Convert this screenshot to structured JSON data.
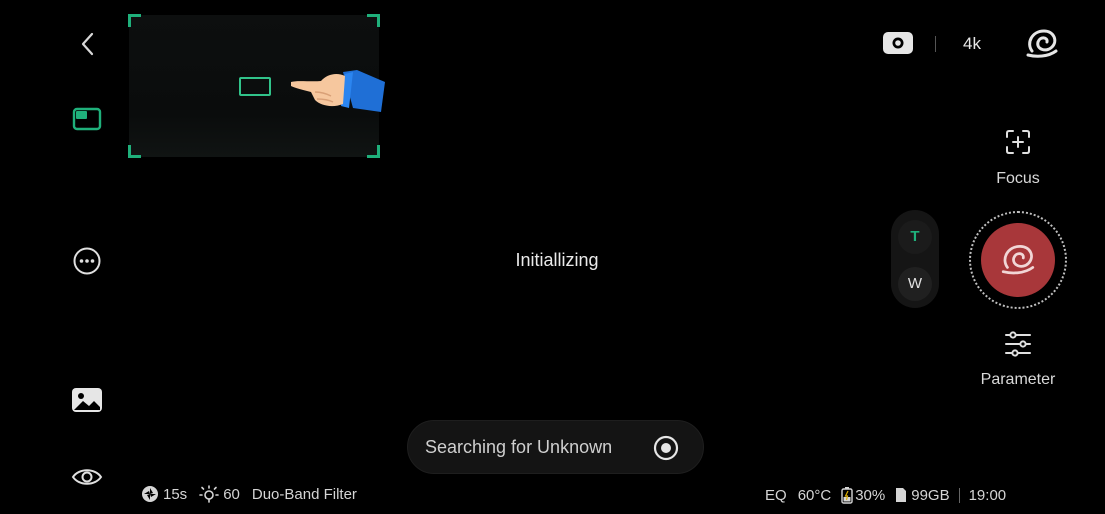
{
  "status": {
    "resolution": "4k",
    "init_text": "Initiallizing"
  },
  "controls": {
    "focus_label": "Focus",
    "parameter_label": "Parameter",
    "zoom_tele": "T",
    "zoom_wide": "W"
  },
  "task": {
    "searching_text": "Searching for Unknown"
  },
  "bottom_left": {
    "exposure": "15s",
    "gain": "60",
    "filter": "Duo-Band Filter"
  },
  "bottom_right": {
    "eq": "EQ",
    "temperature": "60°C",
    "battery": "30%",
    "storage": "99GB",
    "time": "19:00"
  },
  "colors": {
    "accent": "#1fb07b",
    "shutter": "#a8373a",
    "background": "#000000"
  },
  "icons": [
    "back-icon",
    "pip-icon",
    "more-icon",
    "gallery-icon",
    "eye-icon",
    "photo-mode-icon",
    "swirl-icon",
    "focus-icon",
    "parameter-icon",
    "stop-icon",
    "aperture-icon",
    "sun-icon",
    "battery-icon",
    "sd-card-icon"
  ]
}
